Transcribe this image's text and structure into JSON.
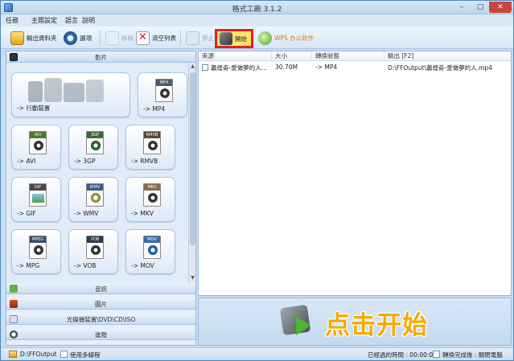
{
  "window": {
    "title": "格式工廠 3.1.2",
    "min": "–",
    "max": "▢",
    "close": "✕"
  },
  "menu": [
    "任務",
    "主題設定",
    "語言",
    "說明"
  ],
  "toolbar": {
    "output_folder": "輸出資料夾",
    "options": "選項",
    "remove": "移除",
    "clear_list": "清空列表",
    "stop": "停止",
    "start": "開始",
    "wps": "WPS 办公软件"
  },
  "categories": {
    "video": "影片",
    "audio": "音訊",
    "picture": "圖片",
    "rom": "光碟機裝置\\DVD\\CD\\ISO",
    "advanced": "進階"
  },
  "formats": [
    {
      "label": "-> 行動裝置",
      "tag": ""
    },
    {
      "label": "-> MP4",
      "tag": "MP4"
    },
    {
      "label": "-> AVI",
      "tag": "AVI"
    },
    {
      "label": "-> 3GP",
      "tag": "3GP"
    },
    {
      "label": "-> RMVB",
      "tag": "RMVB"
    },
    {
      "label": "-> GIF",
      "tag": "GIF"
    },
    {
      "label": "-> WMV",
      "tag": "WMV"
    },
    {
      "label": "-> MKV",
      "tag": "MKV"
    },
    {
      "label": "-> MPG",
      "tag": "MPEG"
    },
    {
      "label": "-> VOB",
      "tag": "VOB"
    },
    {
      "label": "-> MOV",
      "tag": "MOV"
    }
  ],
  "table": {
    "headers": [
      "來源",
      "大小",
      "轉換狀態",
      "輸出 [F2]"
    ],
    "rows": [
      {
        "source": "蕭煌奇-愛做夢的人...",
        "size": "30.70M",
        "status": "-> MP4",
        "output": "D:\\FFOutput\\蕭煌奇-愛做夢的人.mp4"
      }
    ]
  },
  "banner": {
    "text": "点击开始"
  },
  "status": {
    "output_path": "D:\\FFOutput",
    "multithread": "使用多線程",
    "elapsed_label": "已經過的時間 : 00:00:00",
    "after_label": "轉換完成後 : 關閉電腦"
  },
  "colors": {
    "accent": "#f7a800",
    "highlight": "#e02020"
  }
}
